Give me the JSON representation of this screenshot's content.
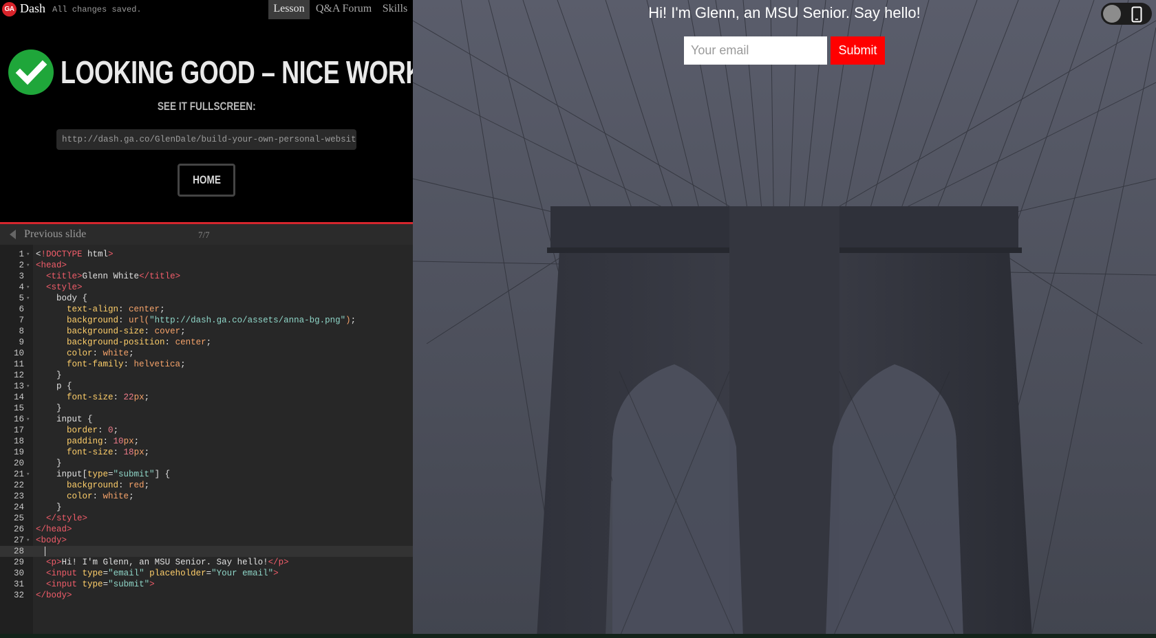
{
  "topbar": {
    "logo_text": "GA",
    "app_name": "Dash",
    "save_status": "All changes saved.",
    "tabs": [
      {
        "label": "Lesson",
        "active": true
      },
      {
        "label": "Q&A Forum",
        "active": false
      },
      {
        "label": "Skills",
        "active": false
      }
    ]
  },
  "success": {
    "heading": "LOOKING GOOD – NICE WORK!",
    "fullscreen_label": "SEE IT FULLSCREEN:",
    "url": "http://dash.ga.co/GlenDale/build-your-own-personal-website",
    "home_label": "HOME",
    "check_color": "#1fa63a"
  },
  "slide_nav": {
    "prev_label": "Previous slide",
    "counter": "7/7"
  },
  "editor": {
    "active_line": 28,
    "lines": [
      {
        "n": "1",
        "fold": true,
        "code": "<!DOCTYPE html>"
      },
      {
        "n": "2",
        "fold": true,
        "code": "<head>"
      },
      {
        "n": "3",
        "fold": false,
        "code": "  <title>Glenn White</title>"
      },
      {
        "n": "4",
        "fold": true,
        "code": "  <style>"
      },
      {
        "n": "5",
        "fold": true,
        "code": "    body {"
      },
      {
        "n": "6",
        "fold": false,
        "code": "      text-align: center;"
      },
      {
        "n": "7",
        "fold": false,
        "code": "      background: url(\"http://dash.ga.co/assets/anna-bg.png\");"
      },
      {
        "n": "8",
        "fold": false,
        "code": "      background-size: cover;"
      },
      {
        "n": "9",
        "fold": false,
        "code": "      background-position: center;"
      },
      {
        "n": "10",
        "fold": false,
        "code": "      color: white;"
      },
      {
        "n": "11",
        "fold": false,
        "code": "      font-family: helvetica;"
      },
      {
        "n": "12",
        "fold": false,
        "code": "    }"
      },
      {
        "n": "13",
        "fold": true,
        "code": "    p {"
      },
      {
        "n": "14",
        "fold": false,
        "code": "      font-size: 22px;"
      },
      {
        "n": "15",
        "fold": false,
        "code": "    }"
      },
      {
        "n": "16",
        "fold": true,
        "code": "    input {"
      },
      {
        "n": "17",
        "fold": false,
        "code": "      border: 0;"
      },
      {
        "n": "18",
        "fold": false,
        "code": "      padding: 10px;"
      },
      {
        "n": "19",
        "fold": false,
        "code": "      font-size: 18px;"
      },
      {
        "n": "20",
        "fold": false,
        "code": "    }"
      },
      {
        "n": "21",
        "fold": true,
        "code": "    input[type=\"submit\"] {"
      },
      {
        "n": "22",
        "fold": false,
        "code": "      background: red;"
      },
      {
        "n": "23",
        "fold": false,
        "code": "      color: white;"
      },
      {
        "n": "24",
        "fold": false,
        "code": "    }"
      },
      {
        "n": "25",
        "fold": false,
        "code": "  </style>"
      },
      {
        "n": "26",
        "fold": false,
        "code": "</head>"
      },
      {
        "n": "27",
        "fold": true,
        "code": "<body>"
      },
      {
        "n": "28",
        "fold": false,
        "code": ""
      },
      {
        "n": "29",
        "fold": false,
        "code": "  <p>Hi! I'm Glenn, an MSU Senior. Say hello!</p>"
      },
      {
        "n": "30",
        "fold": false,
        "code": "  <input type=\"email\" placeholder=\"Your email\">"
      },
      {
        "n": "31",
        "fold": false,
        "code": "  <input type=\"submit\">"
      },
      {
        "n": "32",
        "fold": false,
        "code": "</body>"
      }
    ]
  },
  "preview": {
    "greeting": "Hi! I'm Glenn, an MSU Senior. Say hello!",
    "email_placeholder": "Your email",
    "submit_label": "Submit",
    "submit_color": "#ff0000"
  },
  "icons": {
    "logo": "ga-logo-icon",
    "check": "checkmark-icon",
    "prev": "chevron-left-icon",
    "toggle": "device-toggle-icon",
    "phone": "phone-icon"
  }
}
